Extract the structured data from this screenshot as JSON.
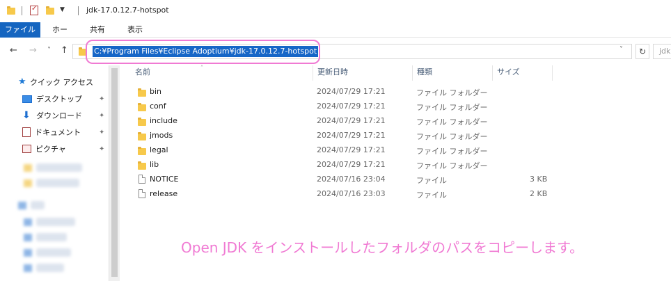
{
  "window": {
    "title": "jdk-17.0.12.7-hotspot"
  },
  "ribbon": {
    "tabs": [
      "ファイル",
      "ホーム",
      "共有",
      "表示"
    ]
  },
  "nav": {
    "back_icon": "←",
    "forward_icon": "→",
    "recent_icon": "˅",
    "up_icon": "↑",
    "address_path": "C:¥Program Files¥Eclipse Adoptium¥jdk-17.0.12.7-hotspot",
    "dropdown_icon": "˅",
    "refresh_icon": "↻",
    "search_text": "jdk"
  },
  "sidebar": {
    "quick_access": "クイック アクセス",
    "items": [
      "デスクトップ",
      "ダウンロード",
      "ドキュメント",
      "ピクチャ"
    ],
    "pin_icon": "📌"
  },
  "columns": {
    "name": "名前",
    "date": "更新日時",
    "type": "種類",
    "size": "サイズ"
  },
  "files": [
    {
      "name": "bin",
      "date": "2024/07/29 17:21",
      "type": "ファイル フォルダー",
      "size": "",
      "kind": "folder"
    },
    {
      "name": "conf",
      "date": "2024/07/29 17:21",
      "type": "ファイル フォルダー",
      "size": "",
      "kind": "folder"
    },
    {
      "name": "include",
      "date": "2024/07/29 17:21",
      "type": "ファイル フォルダー",
      "size": "",
      "kind": "folder"
    },
    {
      "name": "jmods",
      "date": "2024/07/29 17:21",
      "type": "ファイル フォルダー",
      "size": "",
      "kind": "folder"
    },
    {
      "name": "legal",
      "date": "2024/07/29 17:21",
      "type": "ファイル フォルダー",
      "size": "",
      "kind": "folder"
    },
    {
      "name": "lib",
      "date": "2024/07/29 17:21",
      "type": "ファイル フォルダー",
      "size": "",
      "kind": "folder"
    },
    {
      "name": "NOTICE",
      "date": "2024/07/16 23:04",
      "type": "ファイル",
      "size": "3 KB",
      "kind": "file"
    },
    {
      "name": "release",
      "date": "2024/07/16 23:03",
      "type": "ファイル",
      "size": "2 KB",
      "kind": "file"
    }
  ],
  "caption": "Open JDK をインストールしたフォルダのパスをコピーします。",
  "colors": {
    "accent": "#1565c0",
    "selection": "#1666c7",
    "highlight": "#f07ad3",
    "folder": "#f7c94b"
  }
}
